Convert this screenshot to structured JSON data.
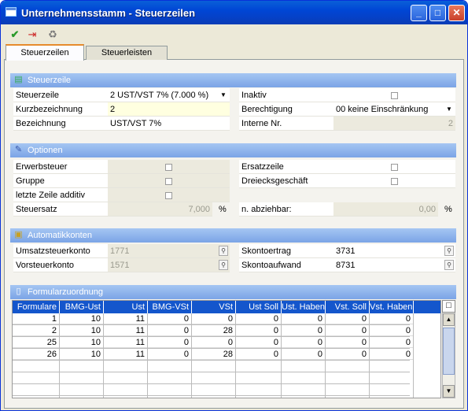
{
  "window": {
    "title": "Unternehmensstamm - Steuerzeilen",
    "min": "_",
    "max": "□",
    "close": "✕"
  },
  "toolbar": {
    "ok": "✔",
    "exit": "⇥",
    "delete": "♻"
  },
  "tabs": [
    {
      "label": "Steuerzeilen"
    },
    {
      "label": "Steuerleisten"
    }
  ],
  "steuerzeile": {
    "header": "Steuerzeile",
    "steuerzeile_label": "Steuerzeile",
    "steuerzeile_value": "2   UST/VST 7% (7.000 %)",
    "kurz_label": "Kurzbezeichnung",
    "kurz_value": "2",
    "bez_label": "Bezeichnung",
    "bez_value": "UST/VST 7%",
    "inaktiv_label": "Inaktiv",
    "ber_label": "Berechtigung",
    "ber_value": "00 keine Einschränkung",
    "intern_label": "Interne Nr.",
    "intern_value": "2"
  },
  "optionen": {
    "header": "Optionen",
    "erwerb_label": "Erwerbsteuer",
    "gruppe_label": "Gruppe",
    "letzte_label": "letzte Zeile additiv",
    "satz_label": "Steuersatz",
    "satz_value": "7,000",
    "satz_unit": "%",
    "ersatz_label": "Ersatzzeile",
    "dreieck_label": "Dreiecksgeschäft",
    "abz_label": "n. abziehbar:",
    "abz_value": "0,00",
    "abz_unit": "%"
  },
  "konten": {
    "header": "Automatikkonten",
    "ust_label": "Umsatzsteuerkonto",
    "ust_value": "1771",
    "vst_label": "Vorsteuerkonto",
    "vst_value": "1571",
    "sk_ertrag_label": "Skontoertrag",
    "sk_ertrag_value": "3731",
    "sk_aufw_label": "Skontoaufwand",
    "sk_aufw_value": "8731"
  },
  "formular": {
    "header": "Formularzuordnung",
    "columns": [
      "Formulare",
      "BMG-Ust",
      "Ust",
      "BMG-VSt",
      "VSt",
      "Ust Soll",
      "Ust. Haben",
      "Vst. Soll",
      "Vst. Haben"
    ],
    "rows": [
      [
        "1",
        "10",
        "11",
        "0",
        "0",
        "0",
        "0",
        "0",
        "0"
      ],
      [
        "2",
        "10",
        "11",
        "0",
        "28",
        "0",
        "0",
        "0",
        "0"
      ],
      [
        "25",
        "10",
        "11",
        "0",
        "0",
        "0",
        "0",
        "0",
        "0"
      ],
      [
        "26",
        "10",
        "11",
        "0",
        "28",
        "0",
        "0",
        "0",
        "0"
      ]
    ],
    "scroll_up": "▲",
    "scroll_down": "▼",
    "corner": "□"
  }
}
